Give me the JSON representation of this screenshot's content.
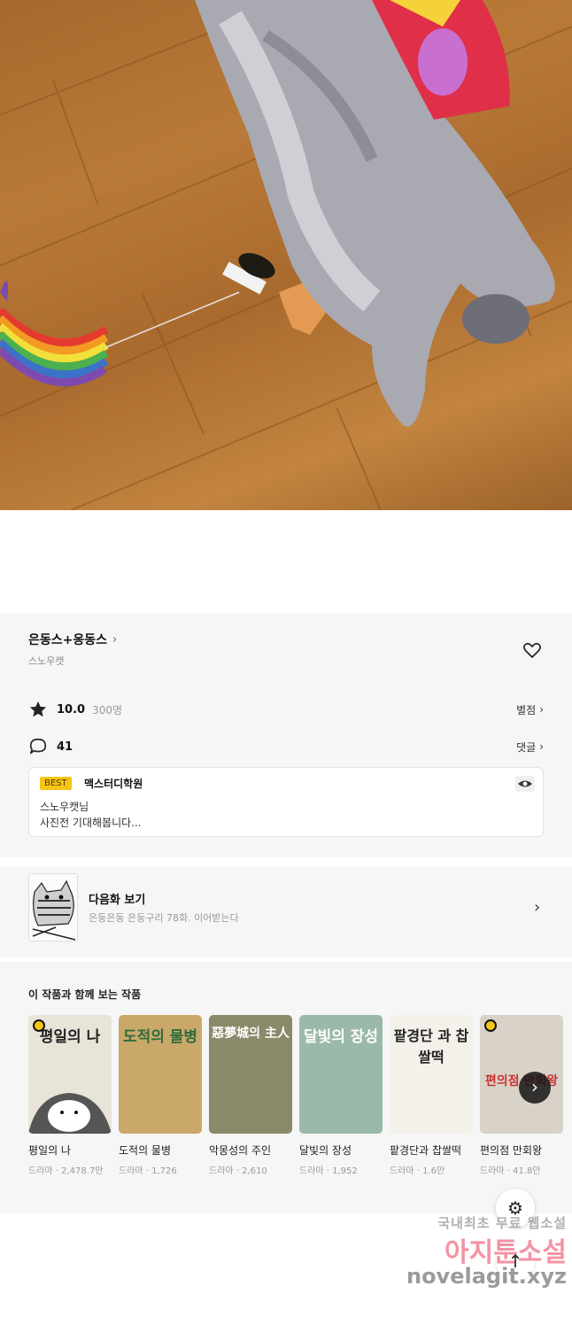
{
  "work": {
    "title": "은동스+옹동스",
    "author": "스노우캣"
  },
  "stats": {
    "rating": "10.0",
    "rating_count": "300명",
    "rating_link": "별점",
    "comments": "41",
    "comments_link": "댓글"
  },
  "best_comment": {
    "badge": "BEST",
    "commenter": "맥스터디학원",
    "line1": "스노우캣님",
    "line2": "사진전 기대해봅니다..."
  },
  "next_episode": {
    "label": "다음화 보기",
    "subtitle": "은둥은둥 은둥구리 78화. 이어받는다"
  },
  "related": {
    "heading": "이 작품과 함께 보는 작품",
    "items": [
      {
        "title": "평일의 나",
        "meta": "드라마 · 2,478.7만",
        "cover_text": "평일의 나",
        "bg": "#e9e4d8"
      },
      {
        "title": "도적의 물병",
        "meta": "드라마 · 1,726",
        "cover_text": "도적의 물병",
        "bg": "#c9a86a"
      },
      {
        "title": "악몽성의 주인",
        "meta": "드라마 · 2,610",
        "cover_text": "惡夢城의 主人",
        "bg": "#8a8a6a"
      },
      {
        "title": "달빛의 장성",
        "meta": "드라마 · 1,952",
        "cover_text": "달빛의 장성",
        "bg": "#9bb9a8"
      },
      {
        "title": "팥경단과 찹쌀떡",
        "meta": "드라마 · 1.6만",
        "cover_text": "팥경단 과 찹쌀떡",
        "bg": "#f4f1ea"
      },
      {
        "title": "편의점 만회왕",
        "meta": "드라마 · 41.8만",
        "cover_text": "편의점 만회왕",
        "bg": "#d8d2c8"
      }
    ]
  },
  "watermark": {
    "line1": "국내최초 무료 웹소설",
    "line2": "아지툰소설",
    "line3": "novelagit.xyz"
  },
  "colors": {
    "best_badge": "#f5c518",
    "section_bg": "#f6f6f6"
  }
}
